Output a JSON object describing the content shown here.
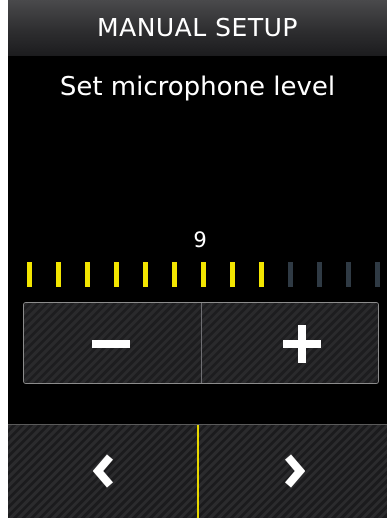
{
  "header": {
    "title": "MANUAL SETUP"
  },
  "subtitle": "Set microphone level",
  "level": {
    "value": "9",
    "current": 9,
    "max": 13
  },
  "colors": {
    "active_tick": "#f2e500",
    "inactive_tick": "#2f3a44",
    "nav_divider": "#e8d800"
  },
  "controls": {
    "decrease": {
      "icon": "minus-icon"
    },
    "increase": {
      "icon": "plus-icon"
    }
  },
  "navigation": {
    "back": {
      "icon": "chevron-left-icon"
    },
    "forward": {
      "icon": "chevron-right-icon"
    }
  }
}
